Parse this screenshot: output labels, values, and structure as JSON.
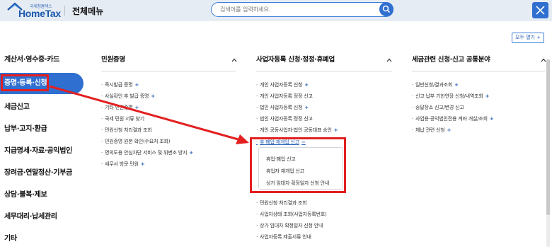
{
  "header": {
    "logo_sub": "국세청홈택스",
    "logo_main": "HomeTax",
    "menu_title": "전체메뉴",
    "search_placeholder": "검색어를 입력하세요.",
    "open_all_label": "모두 열기 +"
  },
  "left_nav": {
    "items": [
      {
        "label": "계산서·영수증·카드"
      },
      {
        "label": "증명·등록·신청"
      },
      {
        "label": "세금신고"
      },
      {
        "label": "납부·고지·환급"
      },
      {
        "label": "지급명세·자료·공익법인"
      },
      {
        "label": "장려금·연말정산·기부금"
      },
      {
        "label": "상담·불복·제보"
      },
      {
        "label": "세무대리·납세관리"
      },
      {
        "label": "기타"
      }
    ],
    "active_index": 1
  },
  "columns": [
    {
      "title": "민원증명",
      "items": [
        {
          "label": "즉시발급 증명",
          "plus": "+"
        },
        {
          "label": "사실확인 후 발급 증명",
          "plus": "+"
        },
        {
          "label": "기타 민원증명",
          "plus": "+"
        },
        {
          "label": "국세 민원 서류 찾기",
          "plus": ""
        },
        {
          "label": "민원신청 처리결과 조회",
          "plus": ""
        },
        {
          "label": "민원증명 원본 확인(수요처 조회)",
          "plus": ""
        },
        {
          "label": "명의도용 안심차단 서비스 및 위변조 방지",
          "plus": "+"
        },
        {
          "label": "세무서 방문 민원",
          "plus": "+"
        }
      ]
    },
    {
      "title": "사업자등록 신청·정정·휴폐업",
      "items": [
        {
          "label": "개인 사업자등록 신청",
          "plus": "+"
        },
        {
          "label": "개인 사업자등록 정정 신고",
          "plus": ""
        },
        {
          "label": "법인 사업자등록 신청",
          "plus": "+"
        },
        {
          "label": "법인 사업자등록 정정 신고",
          "plus": ""
        },
        {
          "label": "개인 공동사업자·법인 공동대표 승인",
          "plus": "+"
        },
        {
          "label": "휴·폐업·재개업 신고",
          "plus": "−"
        },
        {
          "label": "민원신청 처리결과 조회",
          "plus": ""
        },
        {
          "label": "사업자상태 조회(사업자등록번호)",
          "plus": ""
        },
        {
          "label": "상가 임대차 확정일자 신청 안내",
          "plus": ""
        },
        {
          "label": "사업자등록 제출서류 안내",
          "plus": ""
        }
      ],
      "submenu": [
        {
          "label": "휴업·폐업 신고"
        },
        {
          "label": "휴업자 재개업 신고"
        },
        {
          "label": "상가 임대차 확정일자 신청 안내"
        }
      ]
    },
    {
      "title": "세금관련 신청·신고 공통분야",
      "items": [
        {
          "label": "일반신청/결과조회",
          "plus": "+"
        },
        {
          "label": "신고·납부 기한연장 신청/내역조회",
          "plus": "+"
        },
        {
          "label": "송달장소 신고/변경 신고",
          "plus": ""
        },
        {
          "label": "사업용·공익법인전용 계좌 개설/조회",
          "plus": "+"
        },
        {
          "label": "체납 관련 신청",
          "plus": "+"
        }
      ]
    }
  ],
  "colors": {
    "accent": "#2f6fd0",
    "highlight": "#e32020",
    "header_bg": "#e6ecf4"
  }
}
